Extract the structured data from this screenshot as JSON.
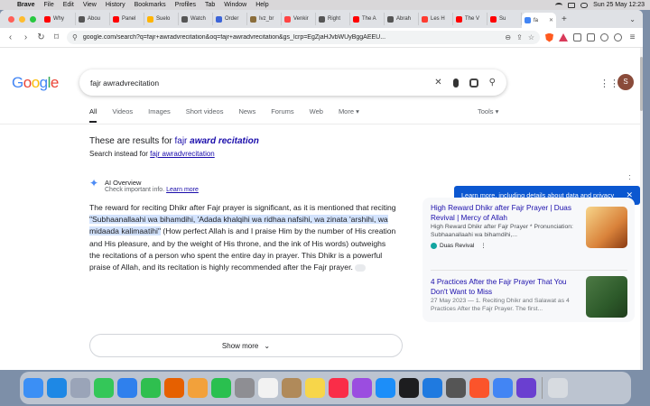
{
  "menubar": {
    "app": "Brave",
    "items": [
      "File",
      "Edit",
      "View",
      "History",
      "Bookmarks",
      "Profiles",
      "Tab",
      "Window",
      "Help"
    ],
    "clock": "Sun 25 May  12:23"
  },
  "tabs": [
    {
      "label": "Why",
      "color": "#ff0000"
    },
    {
      "label": "Abou",
      "color": "#555555"
    },
    {
      "label": "Panel",
      "color": "#ff0000"
    },
    {
      "label": "Suelo",
      "color": "#ffb400"
    },
    {
      "label": "Watch",
      "color": "#555555"
    },
    {
      "label": "Order",
      "color": "#3c64d8"
    },
    {
      "label": "Ivz_br",
      "color": "#8a6d3b"
    },
    {
      "label": "Venkir",
      "color": "#ff4444"
    },
    {
      "label": "Right",
      "color": "#555555"
    },
    {
      "label": "The A",
      "color": "#ff0000"
    },
    {
      "label": "Abrah",
      "color": "#555555"
    },
    {
      "label": "Les H",
      "color": "#ff3b30"
    },
    {
      "label": "The V",
      "color": "#ff0000"
    },
    {
      "label": "Su",
      "color": "#ff0000"
    },
    {
      "label": "fa",
      "color": "#4285f4",
      "active": true
    }
  ],
  "address_bar": {
    "url": "google.com/search?q=fajr+awradvrecitation&oq=fajr+awradvrecitation&gs_lcrp=EgZjaHJvbWUyBggAEEU..."
  },
  "google": {
    "logo_letters": [
      {
        "ch": "G",
        "color": "#4285f4"
      },
      {
        "ch": "o",
        "color": "#ea4335"
      },
      {
        "ch": "o",
        "color": "#fbbc05"
      },
      {
        "ch": "g",
        "color": "#4285f4"
      },
      {
        "ch": "l",
        "color": "#34a853"
      },
      {
        "ch": "e",
        "color": "#ea4335"
      }
    ],
    "query": "fajr awradvrecitation",
    "avatar_letter": "S",
    "filters": [
      "All",
      "Videos",
      "Images",
      "Short videos",
      "News",
      "Forums",
      "Web",
      "More ▾"
    ],
    "tools": "Tools ▾"
  },
  "correction": {
    "prefix": "These are results for ",
    "word1": "fajr ",
    "word2": "award recitation",
    "instead_prefix": "Search instead for ",
    "instead_link": "fajr awradvrecitation"
  },
  "ai_overview": {
    "title": "AI Overview",
    "sub_prefix": "Check important info. ",
    "sub_link": "Learn more",
    "text_a": "The reward for reciting Dhikr after Fajr prayer is significant, as it is mentioned that reciting ",
    "text_hl": "\"Subhaanallaahi wa bihamdihi, 'Adada khalqihi wa ridhaa nafsihi, wa zinata 'arshihi, wa midaada kalimaatihi\"",
    "text_b": " (How perfect Allah is and I praise Him by the number of His creation and His pleasure, and by the weight of His throne, and the ink of His words) outweighs the recitations of a person who spent the entire day in prayer. This Dhikr is a powerful praise of Allah, and its recitation is highly recommended after the Fajr prayer.",
    "show_more": "Show more"
  },
  "tooltip": "Learn more, including details about data and privacy",
  "sources": [
    {
      "title": "High Reward Dhikr after Fajr Prayer | Duas Revival | Mercy of Allah",
      "snippet": "High Reward Dhikr after Fajr Prayer * Pronunciation: Subhaanallaahi wa bihamdihi,...",
      "site": "Duas Revival"
    },
    {
      "title": "4 Practices After the Fajr Prayer That You Don't Want to Miss",
      "snippet": "27 May 2023 — 1. Reciting Dhikr and Salawat as 4 Practices After the Fajr Prayer. The first..."
    }
  ],
  "dock": [
    {
      "name": "finder",
      "color": "#3b8ff5"
    },
    {
      "name": "safari",
      "color": "#1e88e5"
    },
    {
      "name": "launchpad",
      "color": "#9aa4b8"
    },
    {
      "name": "messages",
      "color": "#34c759"
    },
    {
      "name": "mail",
      "color": "#2f80ed"
    },
    {
      "name": "numbers",
      "color": "#2fbf4f"
    },
    {
      "name": "firefox",
      "color": "#e66000"
    },
    {
      "name": "photos",
      "color": "#f2a13b"
    },
    {
      "name": "facetime",
      "color": "#2ac04f"
    },
    {
      "name": "settings",
      "color": "#8e8e93"
    },
    {
      "name": "reminders",
      "color": "#f2f2f2"
    },
    {
      "name": "keka",
      "color": "#b08a5a"
    },
    {
      "name": "notes",
      "color": "#f7d64a"
    },
    {
      "name": "music",
      "color": "#fa2d48"
    },
    {
      "name": "podcasts",
      "color": "#9b4de0"
    },
    {
      "name": "app-store",
      "color": "#1c8ef9"
    },
    {
      "name": "apple-tv",
      "color": "#1d1d1f"
    },
    {
      "name": "keynote",
      "color": "#1f7ae0"
    },
    {
      "name": "calculator",
      "color": "#555555"
    },
    {
      "name": "brave",
      "color": "#fb542b"
    },
    {
      "name": "drive",
      "color": "#4285f4"
    },
    {
      "name": "audio",
      "color": "#6a3fd0"
    },
    {
      "name": "trash",
      "color": "#d7dbe0"
    }
  ]
}
